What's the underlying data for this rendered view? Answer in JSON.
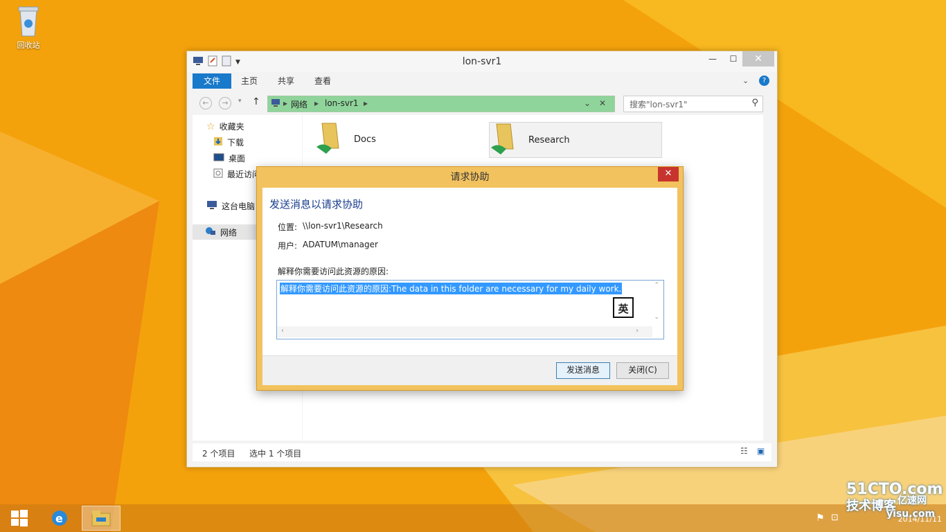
{
  "desktop": {
    "recycle_bin_label": "回收站"
  },
  "explorer": {
    "title": "lon-svr1",
    "ribbon_tabs": [
      "文件",
      "主页",
      "共享",
      "查看"
    ],
    "address": {
      "segments": [
        "网络",
        "lon-svr1"
      ]
    },
    "search_placeholder": "搜索\"lon-svr1\"",
    "nav": {
      "favorites": "收藏夹",
      "downloads": "下载",
      "desktop": "桌面",
      "recent": "最近访问",
      "this_pc": "这台电脑",
      "network": "网络"
    },
    "folders": [
      {
        "name": "Docs"
      },
      {
        "name": "Research"
      }
    ],
    "status": {
      "item_count": "2 个项目",
      "selected": "选中 1 个项目"
    }
  },
  "dialog": {
    "title": "请求协助",
    "heading": "发送消息以请求协助",
    "location_label": "位置:",
    "location_value": "\\\\lon-svr1\\Research",
    "user_label": "用户:",
    "user_value": "ADATUM\\manager",
    "explain_label": "解释你需要访问此资源的原因:",
    "message_text": "解释你需要访问此资源的原因:The data in this folder are necessary for my daily work.",
    "ime_indicator": "英",
    "send_button": "发送消息",
    "close_button": "关闭(C)"
  },
  "taskbar": {
    "date": "2014/11/11"
  },
  "watermark": {
    "line1": "51CTO.com",
    "line2": "技术博客",
    "line3": "亿速网",
    "line4": "yisu.com"
  },
  "colors": {
    "desktop_bg": "#f5a70e",
    "dialog_frame": "#f2c25f",
    "file_tab": "#1979ca",
    "address_bar": "#8fd49a",
    "selection": "#3399ff"
  }
}
